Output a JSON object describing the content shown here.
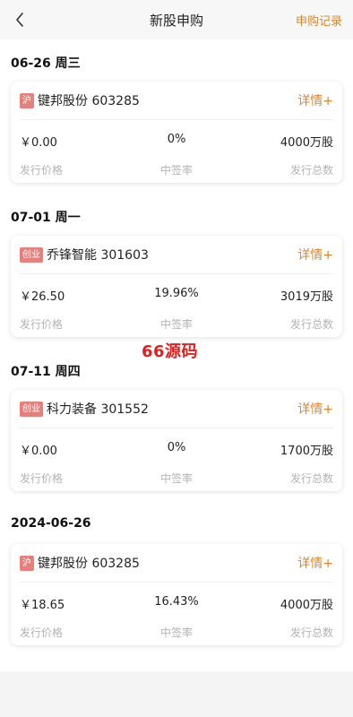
{
  "header": {
    "title": "新股申购",
    "records_label": "申购记录"
  },
  "watermark": "66源码",
  "groups": [
    {
      "date": "06-26 周三",
      "stocks": [
        {
          "tag": "沪",
          "name": "键邦股份 603285",
          "detail": "详情+",
          "price": "￥0.00",
          "rate": "0%",
          "total": "4000万股",
          "labels": {
            "price": "发行价格",
            "rate": "中签率",
            "total": "发行总数"
          }
        }
      ]
    },
    {
      "date": "07-01 周一",
      "stocks": [
        {
          "tag": "创业",
          "name": "乔锋智能 301603",
          "detail": "详情+",
          "price": "￥26.50",
          "rate": "19.96%",
          "total": "3019万股",
          "labels": {
            "price": "发行价格",
            "rate": "中签率",
            "total": "发行总数"
          }
        }
      ]
    },
    {
      "date": "07-11 周四",
      "stocks": [
        {
          "tag": "创业",
          "name": "科力装备 301552",
          "detail": "详情+",
          "price": "￥0.00",
          "rate": "0%",
          "total": "1700万股",
          "labels": {
            "price": "发行价格",
            "rate": "中签率",
            "total": "发行总数"
          }
        }
      ]
    },
    {
      "date": "2024-06-26",
      "stocks": [
        {
          "tag": "沪",
          "name": "键邦股份 603285",
          "detail": "详情+",
          "price": "￥18.65",
          "rate": "16.43%",
          "total": "4000万股",
          "labels": {
            "price": "发行价格",
            "rate": "中签率",
            "total": "发行总数"
          }
        }
      ]
    }
  ],
  "colors": {
    "accent": "#d9862c",
    "tag_bg": "#e7807b",
    "watermark": "#e02020"
  },
  "icons": {
    "back": "chevron-left-icon"
  }
}
